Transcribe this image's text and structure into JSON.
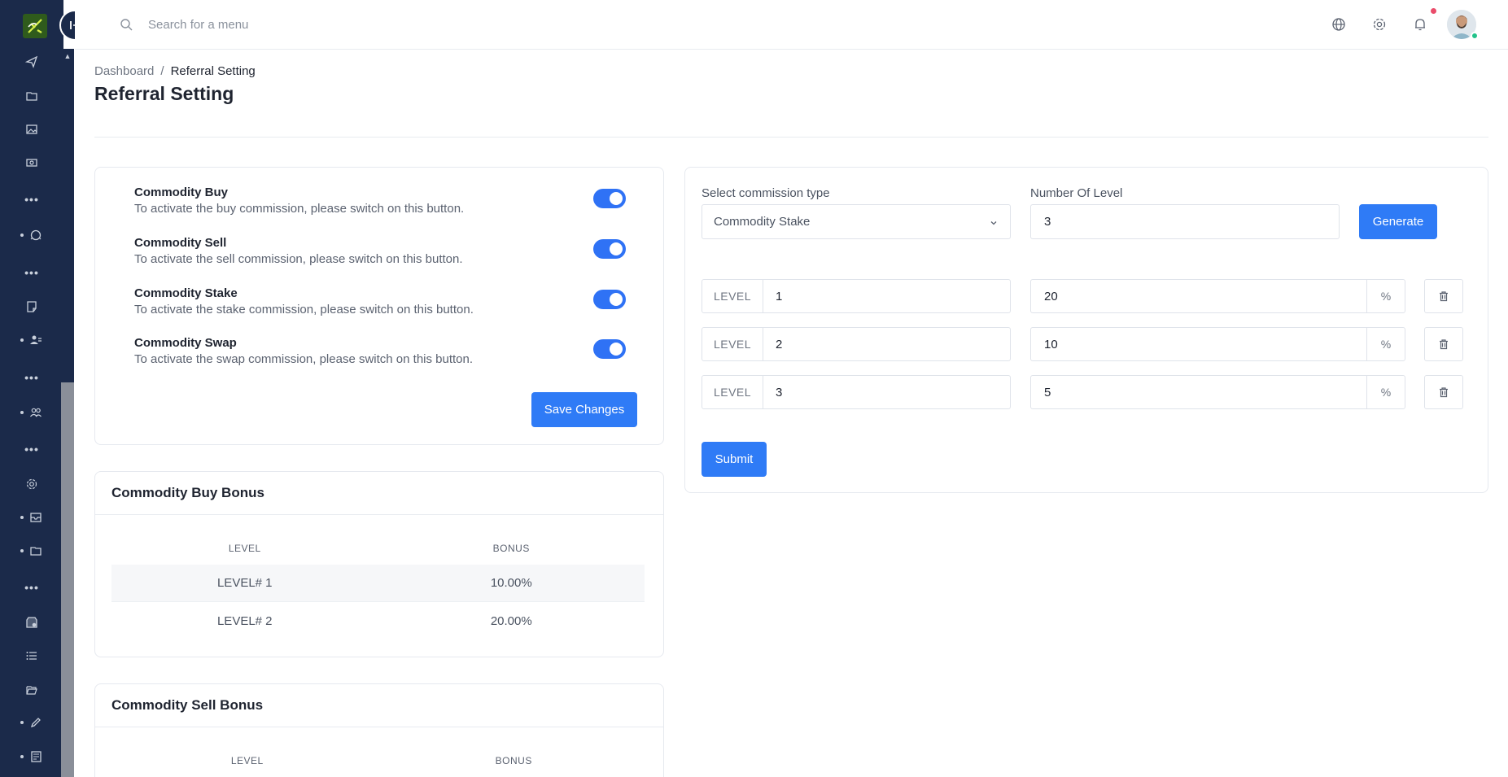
{
  "topbar": {
    "search_placeholder": "Search for a menu",
    "icons": [
      "globe-icon",
      "gear-icon",
      "bell-icon"
    ]
  },
  "sidebar": {
    "items": [
      {
        "icon": "send-icon",
        "bullet": false
      },
      {
        "icon": "folder-icon",
        "bullet": false
      },
      {
        "icon": "image-icon",
        "bullet": false
      },
      {
        "icon": "cash-icon",
        "bullet": false
      },
      {
        "icon": "more-dots",
        "bullet": false
      },
      {
        "icon": "support-icon",
        "bullet": true
      },
      {
        "icon": "more-dots",
        "bullet": false
      },
      {
        "icon": "note-icon",
        "bullet": false
      },
      {
        "icon": "user-group-icon",
        "bullet": true
      },
      {
        "icon": "more-dots",
        "bullet": false
      },
      {
        "icon": "users-icon",
        "bullet": true
      },
      {
        "icon": "more-dots",
        "bullet": false
      },
      {
        "icon": "gear-icon",
        "bullet": false
      },
      {
        "icon": "inbox-icon",
        "bullet": true
      },
      {
        "icon": "folder-icon",
        "bullet": true
      },
      {
        "icon": "more-dots",
        "bullet": false
      },
      {
        "icon": "store-icon",
        "bullet": false
      },
      {
        "icon": "list-icon",
        "bullet": false
      },
      {
        "icon": "folder-open-icon",
        "bullet": false
      },
      {
        "icon": "pencil-icon",
        "bullet": true
      },
      {
        "icon": "newspaper-icon",
        "bullet": true
      }
    ]
  },
  "breadcrumb": {
    "home": "Dashboard",
    "separator": "/",
    "current": "Referral Setting"
  },
  "page_title": "Referral Setting",
  "toggles": {
    "items": [
      {
        "title": "Commodity Buy",
        "desc": "To activate the buy commission, please switch on this button.",
        "on": true
      },
      {
        "title": "Commodity Sell",
        "desc": "To activate the sell commission, please switch on this button.",
        "on": true
      },
      {
        "title": "Commodity Stake",
        "desc": "To activate the stake commission, please switch on this button.",
        "on": true
      },
      {
        "title": "Commodity Swap",
        "desc": "To activate the swap commission, please switch on this button.",
        "on": true
      }
    ],
    "save_label": "Save Changes"
  },
  "buy_bonus": {
    "title": "Commodity Buy Bonus",
    "headers": [
      "LEVEL",
      "BONUS"
    ],
    "rows": [
      [
        "LEVEL# 1",
        "10.00%"
      ],
      [
        "LEVEL# 2",
        "20.00%"
      ]
    ]
  },
  "sell_bonus": {
    "title": "Commodity Sell Bonus",
    "headers": [
      "LEVEL",
      "BONUS"
    ]
  },
  "commission_form": {
    "type_label": "Select commission type",
    "type_value": "Commodity Stake",
    "levels_label": "Number Of Level",
    "levels_value": "3",
    "generate_label": "Generate",
    "level_prefix": "LEVEL",
    "percent_suffix": "%",
    "rows": [
      {
        "level": "1",
        "percent": "20"
      },
      {
        "level": "2",
        "percent": "10"
      },
      {
        "level": "3",
        "percent": "5"
      }
    ],
    "submit_label": "Submit"
  },
  "colors": {
    "sidebar": "#1b2a4a",
    "primary": "#2f7bf6",
    "notification": "#ea4c6a",
    "online": "#22c28a"
  }
}
